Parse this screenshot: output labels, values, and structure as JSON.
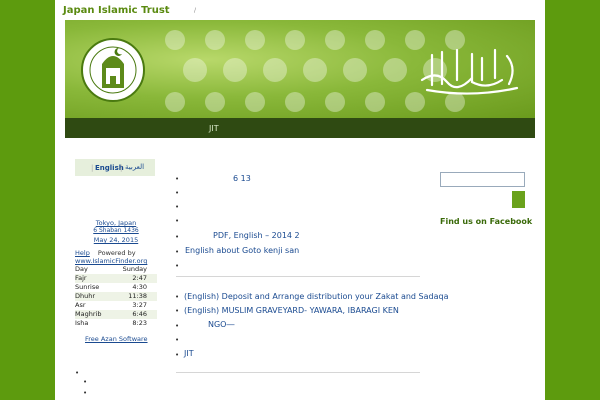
{
  "site": {
    "title": "Japan Islamic Trust",
    "tagline": "/"
  },
  "banner": {
    "logo_text": "Japan Islamic Trust",
    "colors": {
      "primary": "#5d9b0e",
      "dark": "#2f4a12",
      "link": "#1a4a90"
    }
  },
  "nav": {
    "items": [
      "JIT"
    ]
  },
  "lang": {
    "english": "English",
    "separator": "|",
    "arabic": "العربية"
  },
  "prayer": {
    "city": "Tokyo",
    "country": "Japan",
    "hijri": "6 Shaban 1436",
    "date": "May 24, 2015",
    "help": "Help",
    "powered": "Powered by",
    "source": "www.IslamicFinder.org",
    "day_label": "Day",
    "day_value": "Sunday",
    "times": [
      {
        "name": "Fajr",
        "time": "2:47"
      },
      {
        "name": "Sunrise",
        "time": "4:30"
      },
      {
        "name": "Dhuhr",
        "time": "11:38"
      },
      {
        "name": "Asr",
        "time": "3:27"
      },
      {
        "name": "Maghrib",
        "time": "6:46"
      },
      {
        "name": "Isha",
        "time": "8:23"
      }
    ],
    "free_azan": "Free Azan Software"
  },
  "posts_top": [
    {
      "text": "6 13"
    },
    {
      "text": ""
    },
    {
      "text": ""
    },
    {
      "text": ""
    },
    {
      "text": "PDF, English  – 2014 2"
    },
    {
      "text": "English about Goto kenji san"
    },
    {
      "text": ""
    }
  ],
  "posts_bottom": [
    {
      "text": "(English) Deposit and Arrange distribution your Zakat and Sadaqa"
    },
    {
      "text": "(English) MUSLIM GRAVEYARD- YAWARA, IBARAGI KEN"
    },
    {
      "text": "NGO―"
    },
    {
      "text": ""
    },
    {
      "text": "JIT"
    }
  ],
  "sidebar": {
    "facebook_title": "Find us on Facebook"
  }
}
